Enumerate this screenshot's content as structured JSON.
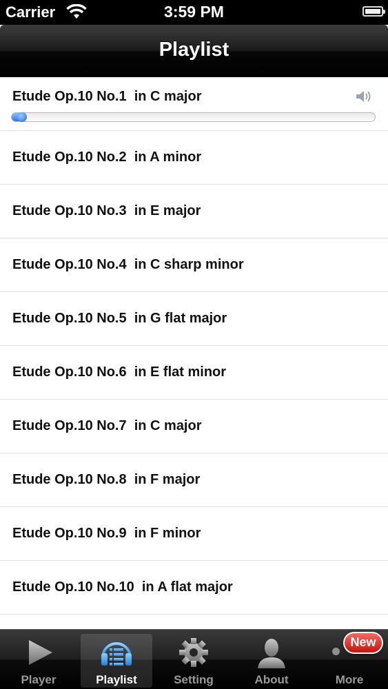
{
  "status_bar": {
    "carrier": "Carrier",
    "time": "3:59 PM"
  },
  "nav": {
    "title": "Playlist"
  },
  "playlist": {
    "playing_index": 0,
    "progress": 0.015,
    "items": [
      "Etude Op.10 No.1  in C major",
      "Etude Op.10 No.2  in A minor",
      "Etude Op.10 No.3  in E major",
      "Etude Op.10 No.4  in C sharp minor",
      "Etude Op.10 No.5  in G flat major",
      "Etude Op.10 No.6  in E flat minor",
      "Etude Op.10 No.7  in C major",
      "Etude Op.10 No.8  in F major",
      "Etude Op.10 No.9  in F minor",
      "Etude Op.10 No.10  in A flat major",
      ""
    ]
  },
  "tabs": [
    {
      "label": "Player",
      "icon": "play-icon",
      "active": false
    },
    {
      "label": "Playlist",
      "icon": "playlist-icon",
      "active": true
    },
    {
      "label": "Setting",
      "icon": "gear-icon",
      "active": false
    },
    {
      "label": "About",
      "icon": "person-icon",
      "active": false
    },
    {
      "label": "More",
      "icon": "more-icon",
      "active": false
    }
  ],
  "badge": {
    "text": "New",
    "color": "#d9241c"
  },
  "colors": {
    "accent": "#2877ea",
    "separator": "#e0e0e6"
  }
}
